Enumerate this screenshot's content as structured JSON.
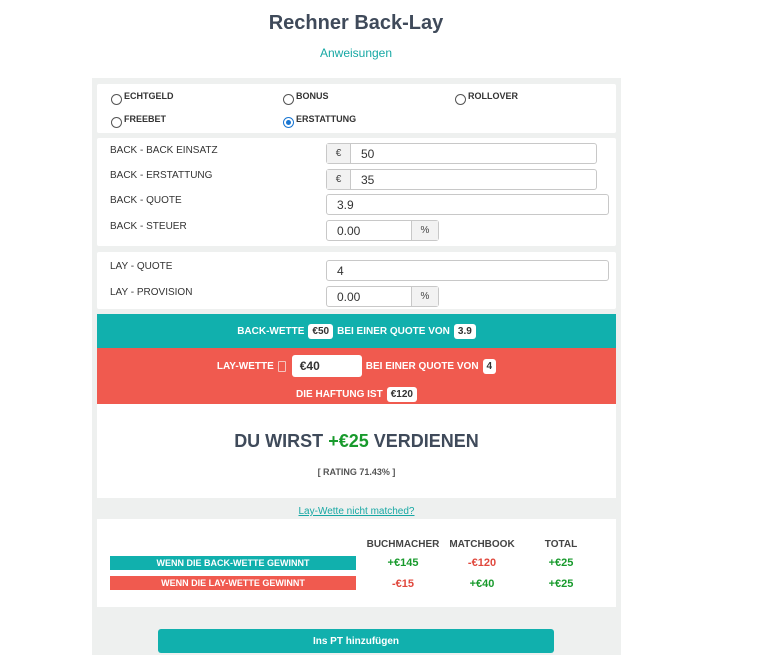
{
  "header": {
    "title": "Rechner Back-Lay",
    "instructions": "Anweisungen"
  },
  "bet_types": [
    {
      "label": "ECHTGELD",
      "selected": false
    },
    {
      "label": "BONUS",
      "selected": false
    },
    {
      "label": "ROLLOVER",
      "selected": false
    },
    {
      "label": "FREEBET",
      "selected": false
    },
    {
      "label": "ERSTATTUNG",
      "selected": true
    }
  ],
  "back": {
    "stake_label": "BACK - BACK EINSATZ",
    "stake_prefix": "€",
    "stake_value": "50",
    "refund_label": "BACK - ERSTATTUNG",
    "refund_prefix": "€",
    "refund_value": "35",
    "odds_label": "BACK - QUOTE",
    "odds_value": "3.9",
    "tax_label": "BACK - STEUER",
    "tax_value": "0.00",
    "tax_suffix": "%"
  },
  "lay": {
    "odds_label": "LAY - QUOTE",
    "odds_value": "4",
    "commission_label": "LAY - PROVISION",
    "commission_value": "0.00",
    "commission_suffix": "%"
  },
  "back_bet_band": {
    "prefix": "BACK-WETTE",
    "stake": "€50",
    "middle": "BEI EINER QUOTE VON",
    "odds": "3.9"
  },
  "lay_bet_band": {
    "prefix": "LAY-WETTE",
    "stake": "€40",
    "middle": "BEI EINER QUOTE VON",
    "odds": "4",
    "liability_label": "DIE HAFTUNG IST",
    "liability": "€120"
  },
  "result": {
    "pre": "DU WIRST",
    "amount": "+€25",
    "post": "VERDIENEN",
    "rating": "[ RATING 71.43% ]"
  },
  "not_matched_link": "Lay-Wette nicht matched?",
  "outcome_table": {
    "headers": [
      "BUCHMACHER",
      "MATCHBOOK",
      "TOTAL"
    ],
    "rows": [
      {
        "label": "WENN DIE BACK-WETTE GEWINNT",
        "bookmaker": "+€145",
        "matchbook": "-€120",
        "total": "+€25"
      },
      {
        "label": "WENN DIE LAY-WETTE GEWINNT",
        "bookmaker": "-€15",
        "matchbook": "+€40",
        "total": "+€25"
      }
    ]
  },
  "add_button": "Ins PT hinzufügen",
  "colors": {
    "teal": "#11b0ad",
    "red": "#f05a4f",
    "positive": "#189a2c",
    "negative": "#e0483d"
  }
}
